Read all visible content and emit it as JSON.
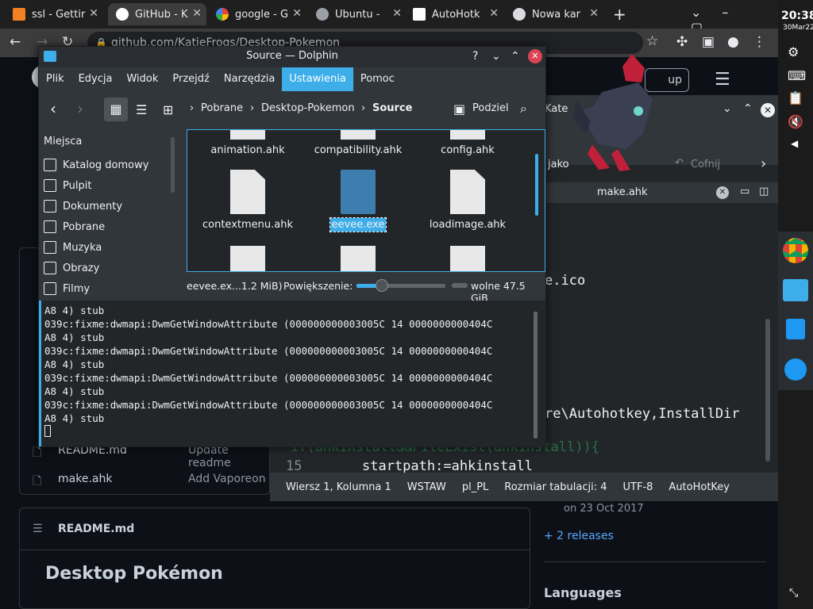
{
  "chrome": {
    "tabs": [
      {
        "label": "ssl - Gettir",
        "icon": "stack-overflow-icon"
      },
      {
        "label": "GitHub - K",
        "icon": "github-icon"
      },
      {
        "label": "google - G",
        "icon": "google-icon"
      },
      {
        "label": "Ubuntu -",
        "icon": "globe-icon"
      },
      {
        "label": "AutoHotk",
        "icon": "autohotkey-icon"
      },
      {
        "label": "Nowa kar",
        "icon": "chrome-icon"
      }
    ],
    "url": "github.com/KatieFrogs/Desktop-Pokemon",
    "new_tab": "+"
  },
  "clock": {
    "time": "20:38",
    "date": "30Mar22"
  },
  "github": {
    "signup": "up",
    "files": [
      {
        "name": "README.md",
        "message": "Update readme"
      },
      {
        "name": "make.ahk",
        "message": "Add Vaporeon"
      }
    ],
    "release_date": "on 23 Oct 2017",
    "releases_link": "+ 2 releases",
    "readme_header": "README.md",
    "readme_title": "Desktop Pokémon",
    "languages": "Languages"
  },
  "dolphin": {
    "title": "Source — Dolphin",
    "menu": [
      "Plik",
      "Edycja",
      "Widok",
      "Przejdź",
      "Narzędzia",
      "Ustawienia",
      "Pomoc"
    ],
    "menu_selected": 5,
    "breadcrumb": [
      "Pobrane",
      "Desktop-Pokemon",
      "Source"
    ],
    "split_label": "Podziel",
    "places_header": "Miejsca",
    "places": [
      "Katalog domowy",
      "Pulpit",
      "Dokumenty",
      "Pobrane",
      "Muzyka",
      "Obrazy",
      "Filmy"
    ],
    "files_row1": [
      "animation.ahk",
      "compatibility.ahk",
      "config.ahk"
    ],
    "files_row2": [
      "contextmenu.ahk",
      "eevee.exe",
      "loadimage.ahk"
    ],
    "status_file": "eevee.ex...1.2 MiB)",
    "zoom_label": "Powiększenie:",
    "free_space": "wolne 47.5 GiB",
    "terminal": [
      "A8 4) stub",
      "039c:fixme:dwmapi:DwmGetWindowAttribute (000000000003005C 14 0000000000404C",
      "A8 4) stub",
      "039c:fixme:dwmapi:DwmGetWindowAttribute (000000000003005C 14 0000000000404C",
      "A8 4) stub",
      "039c:fixme:dwmapi:DwmGetWindowAttribute (000000000003005C 14 0000000000404C",
      "A8 4) stub",
      "039c:fixme:dwmapi:DwmGetWindowAttribute (000000000003005C 14 0000000000404C",
      "A8 4) stub"
    ]
  },
  "kate": {
    "title_fragment": "Kate",
    "undo": "Cofnij",
    "save_as_fragment": "jako",
    "tab": "make.ahk",
    "code": {
      "ico": "e.ico",
      "reg": "re\\Autohotkey,InstallDir",
      "line14": "if(ahkinstall&&FileExist(ahkinstall)){",
      "line15_num": "15",
      "line15": "startpath:=ahkinstall"
    },
    "status": {
      "position": "Wiersz 1, Kolumna 1",
      "mode": "WSTAW",
      "lang": "pl_PL",
      "tabsize": "Rozmiar tabulacji: 4",
      "encoding": "UTF-8",
      "syntax": "AutoHotKey"
    }
  }
}
